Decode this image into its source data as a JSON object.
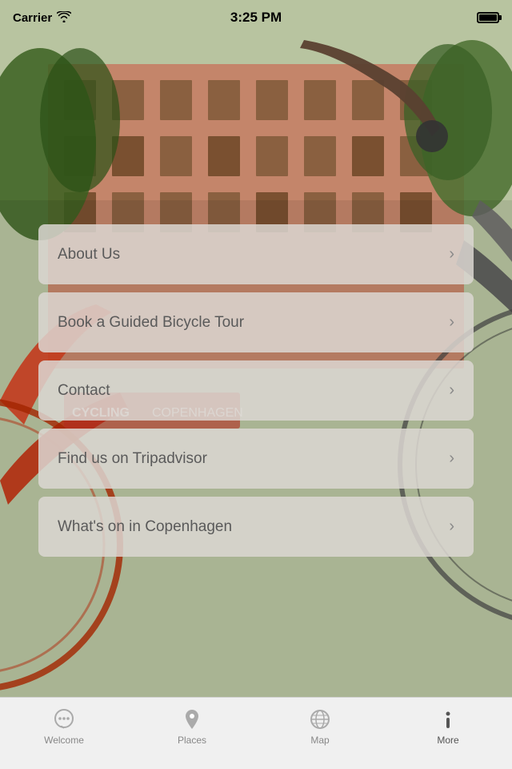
{
  "statusBar": {
    "carrier": "Carrier",
    "time": "3:25 PM"
  },
  "menuItems": [
    {
      "id": "about-us",
      "label": "About Us"
    },
    {
      "id": "book-tour",
      "label": "Book a Guided Bicycle Tour"
    },
    {
      "id": "contact",
      "label": "Contact"
    },
    {
      "id": "tripadvisor",
      "label": "Find us on Tripadvisor"
    },
    {
      "id": "whats-on",
      "label": "What's on in Copenhagen"
    }
  ],
  "tabBar": {
    "items": [
      {
        "id": "welcome",
        "label": "Welcome",
        "icon": "chat-icon"
      },
      {
        "id": "places",
        "label": "Places",
        "icon": "location-icon"
      },
      {
        "id": "map",
        "label": "Map",
        "icon": "globe-icon"
      },
      {
        "id": "more",
        "label": "More",
        "icon": "info-icon",
        "active": true
      }
    ]
  }
}
